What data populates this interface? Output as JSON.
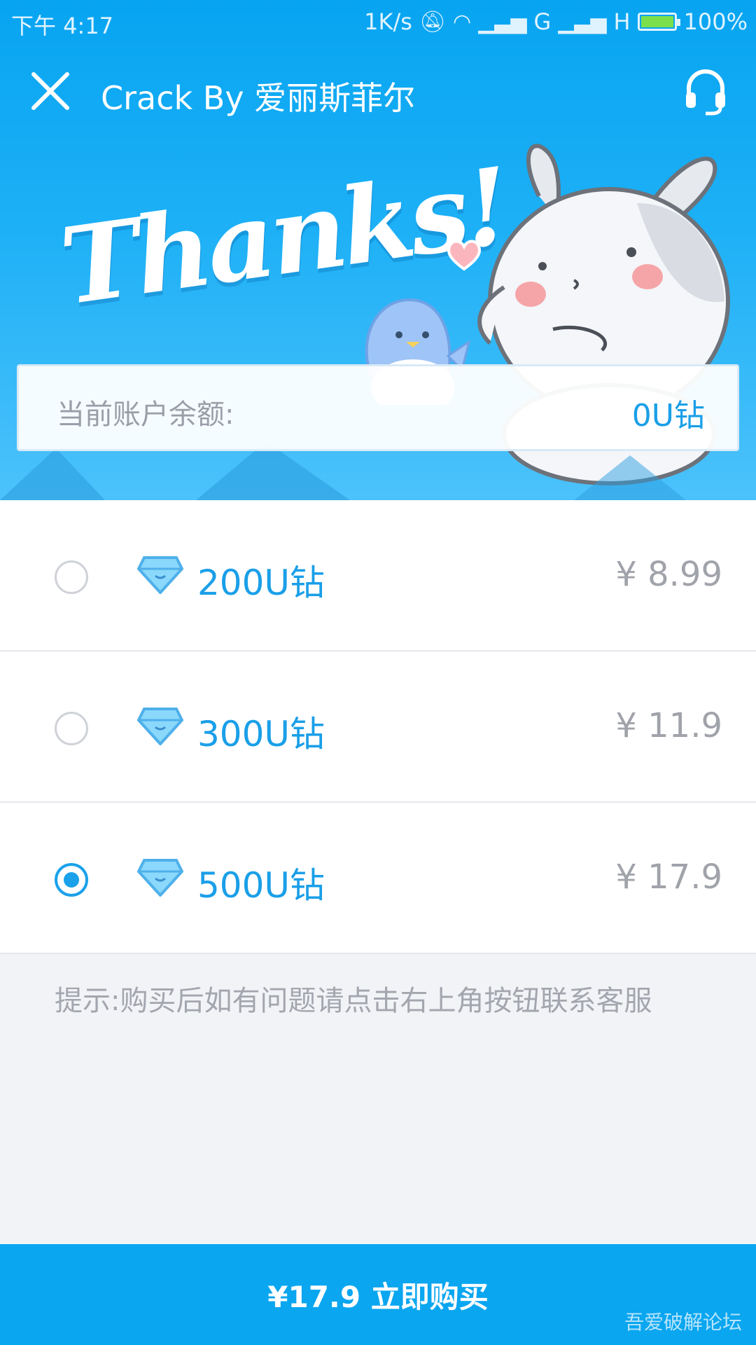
{
  "status_bar": {
    "time": "下午 4:17",
    "network_speed": "1K/s",
    "signal_g": "G",
    "signal_h": "H",
    "battery": "100%"
  },
  "toolbar": {
    "title": "Crack By 爱丽斯菲尔"
  },
  "hero": {
    "thanks_text": "Thanks!"
  },
  "balance": {
    "label": "当前账户余额:",
    "value": "0U钻"
  },
  "options": [
    {
      "label": "200U钻",
      "price": "¥ 8.99",
      "selected": false
    },
    {
      "label": "300U钻",
      "price": "¥ 11.9",
      "selected": false
    },
    {
      "label": "500U钻",
      "price": "¥ 17.9",
      "selected": true
    }
  ],
  "tip": "提示:购买后如有问题请点击右上角按钮联系客服",
  "buy_button": {
    "label": "¥17.9 立即购买"
  },
  "watermark": "吾爱破解论坛",
  "colors": {
    "accent": "#0aa6f0",
    "text_accent": "#1a9fe8",
    "muted": "#a0a3aa"
  }
}
